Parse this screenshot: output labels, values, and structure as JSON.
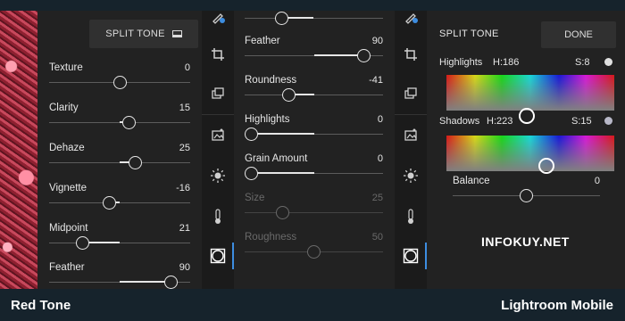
{
  "left_panel": {
    "split_tone_label": "SPLIT TONE",
    "sliders": [
      {
        "label": "Texture",
        "value": "0",
        "level": 0.5
      },
      {
        "label": "Clarity",
        "value": "15",
        "level": 0.575
      },
      {
        "label": "Dehaze",
        "value": "25",
        "level": 0.625
      },
      {
        "label": "Vignette",
        "value": "-16",
        "level": 0.42
      },
      {
        "label": "Midpoint",
        "value": "21",
        "level": 0.21
      },
      {
        "label": "Feather",
        "value": "90",
        "level": 0.9
      }
    ]
  },
  "middle_panel": {
    "sliders": [
      {
        "label": "",
        "value": "",
        "level": 0.24
      },
      {
        "label": "Feather",
        "value": "90",
        "level": 0.9
      },
      {
        "label": "Roundness",
        "value": "-41",
        "level": 0.3
      },
      {
        "label": "Highlights",
        "value": "0",
        "level": 0.0
      },
      {
        "label": "Grain Amount",
        "value": "0",
        "level": 0.0
      },
      {
        "label": "Size",
        "value": "25",
        "level": 0.25
      },
      {
        "label": "Roughness",
        "value": "50",
        "level": 0.5
      }
    ]
  },
  "tools": {
    "icons": [
      "healing-brush-icon",
      "crop-icon",
      "presets-icon",
      "auto-icon",
      "light-icon",
      "color-icon",
      "effects-icon"
    ]
  },
  "right_panel": {
    "title": "SPLIT TONE",
    "done_label": "DONE",
    "highlights": {
      "label": "Highlights",
      "hue": "H:186",
      "sat": "S:8",
      "dot_color": "#e0e0e0"
    },
    "shadows": {
      "label": "Shadows",
      "hue": "H:223",
      "sat": "S:15",
      "dot_color": "#b8b8c8"
    },
    "balance": {
      "label": "Balance",
      "value": "0",
      "level": 0.5
    }
  },
  "watermark": "INFOKUY.NET",
  "captions": {
    "left": "Red Tone",
    "right": "Lightroom Mobile"
  }
}
